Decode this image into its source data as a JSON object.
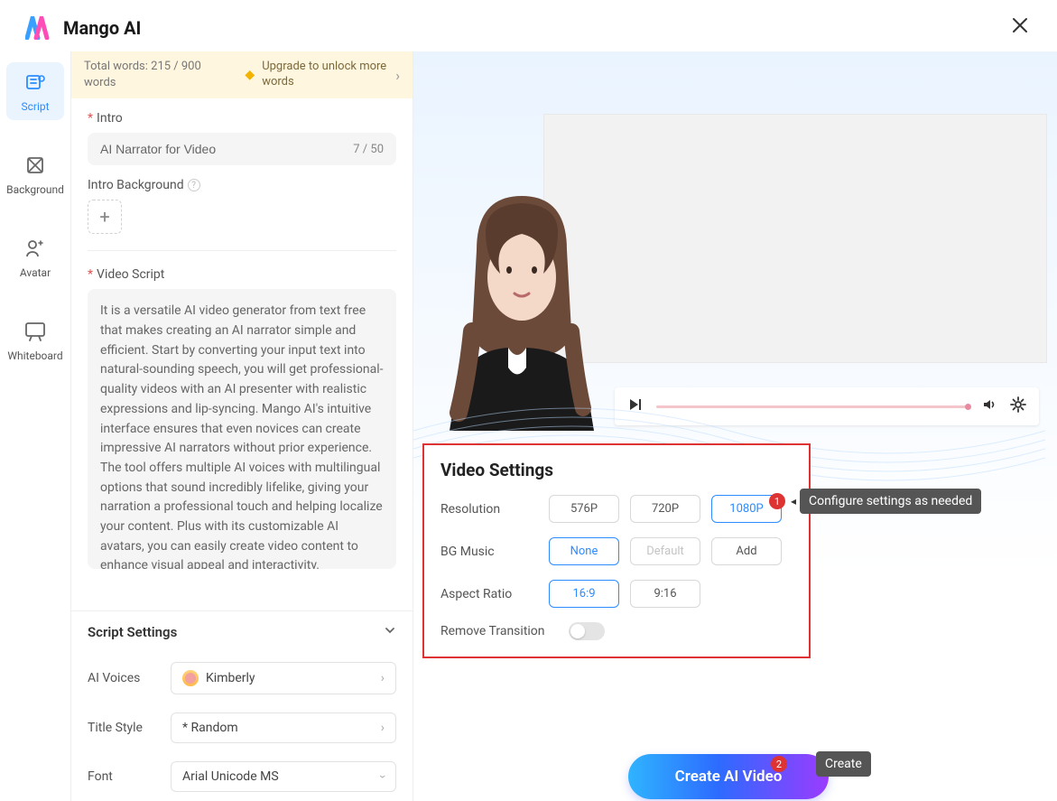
{
  "brand": {
    "name": "Mango AI"
  },
  "sidebar": {
    "tabs": [
      {
        "label": "Script"
      },
      {
        "label": "Background"
      },
      {
        "label": "Avatar"
      },
      {
        "label": "Whiteboard"
      }
    ]
  },
  "wordbar": {
    "count": "Total words: 215 / 900 words",
    "upgrade": "Upgrade to unlock more words"
  },
  "script": {
    "intro_label": "Intro",
    "intro_value": "AI Narrator for Video",
    "intro_counter": "7 / 50",
    "intro_bg_label": "Intro Background",
    "video_script_label": "Video Script",
    "video_script_value": "It is a versatile AI video generator from text free that makes creating an AI narrator simple and efficient. Start by converting your input text into natural-sounding speech, you will get professional-quality videos with an AI presenter with realistic expressions and lip-syncing. Mango AI's intuitive interface ensures that even novices can create impressive AI narrators without prior experience. The tool offers multiple AI voices with multilingual options that sound incredibly lifelike, giving your narration a professional touch and helping localize your content. Plus with its customizable AI avatars, you can easily create video content to enhance visual appeal and interactivity."
  },
  "script_settings": {
    "header": "Script Settings",
    "voices_label": "AI Voices",
    "voices_value": "Kimberly",
    "title_style_label": "Title Style",
    "title_style_value": "* Random",
    "font_label": "Font",
    "font_value": "Arial Unicode MS"
  },
  "video_settings": {
    "title": "Video Settings",
    "resolution_label": "Resolution",
    "resolution_options": [
      "576P",
      "720P",
      "1080P"
    ],
    "resolution_selected": "1080P",
    "bgmusic_label": "BG Music",
    "bgmusic_options": [
      "None",
      "Default",
      "Add"
    ],
    "bgmusic_selected": "None",
    "aspect_label": "Aspect Ratio",
    "aspect_options": [
      "16:9",
      "9:16"
    ],
    "aspect_selected": "16:9",
    "transition_label": "Remove Transition"
  },
  "callouts": {
    "c1_num": "1",
    "c1_text": "Configure settings as needed",
    "c2_num": "2",
    "c2_text": "Create"
  },
  "create_label": "Create AI Video"
}
